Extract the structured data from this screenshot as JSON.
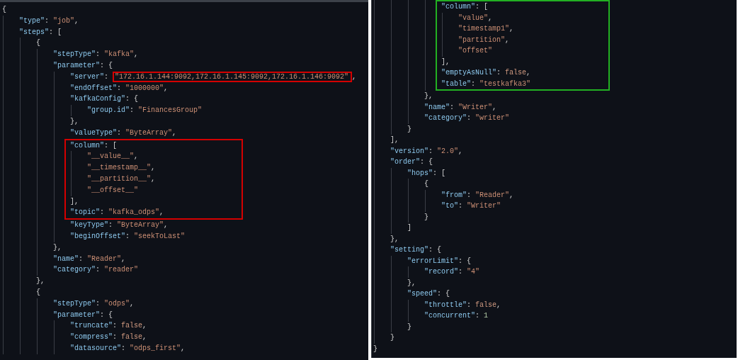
{
  "left": {
    "lines": [
      {
        "kind": "line",
        "tokens": [
          {
            "kind": "punct",
            "text": "{"
          }
        ],
        "children": [
          {
            "kind": "line",
            "tokens": [
              {
                "kind": "key",
                "text": "\"type\""
              },
              {
                "kind": "punct",
                "text": ": "
              },
              {
                "kind": "str",
                "text": "\"job\""
              },
              {
                "kind": "punct",
                "text": ","
              }
            ]
          },
          {
            "kind": "line",
            "tokens": [
              {
                "kind": "key",
                "text": "\"steps\""
              },
              {
                "kind": "punct",
                "text": ": ["
              }
            ],
            "children": [
              {
                "kind": "line",
                "tokens": [
                  {
                    "kind": "punct",
                    "text": "{"
                  }
                ],
                "children": [
                  {
                    "kind": "line",
                    "tokens": [
                      {
                        "kind": "key",
                        "text": "\"stepType\""
                      },
                      {
                        "kind": "punct",
                        "text": ": "
                      },
                      {
                        "kind": "str",
                        "text": "\"kafka\""
                      },
                      {
                        "kind": "punct",
                        "text": ","
                      }
                    ]
                  },
                  {
                    "kind": "line",
                    "tokens": [
                      {
                        "kind": "key",
                        "text": "\"parameter\""
                      },
                      {
                        "kind": "punct",
                        "text": ": {"
                      }
                    ],
                    "children": [
                      {
                        "kind": "line",
                        "tokens": [
                          {
                            "kind": "key",
                            "text": "\"server\""
                          },
                          {
                            "kind": "punct",
                            "text": ": "
                          },
                          {
                            "kind": "str",
                            "text": "\"172.16.1.144:9092,172.16.1.145:9092,172.16.1.146:9092\"",
                            "color": "#d40000"
                          },
                          {
                            "kind": "punct",
                            "text": ","
                          }
                        ]
                      },
                      {
                        "kind": "line",
                        "tokens": [
                          {
                            "kind": "key",
                            "text": "\"endOffset\""
                          },
                          {
                            "kind": "punct",
                            "text": ": "
                          },
                          {
                            "kind": "str",
                            "text": "\"1000000\""
                          },
                          {
                            "kind": "punct",
                            "text": ","
                          }
                        ]
                      },
                      {
                        "kind": "line",
                        "tokens": [
                          {
                            "kind": "key",
                            "text": "\"kafkaConfig\""
                          },
                          {
                            "kind": "punct",
                            "text": ": {"
                          }
                        ],
                        "children": [
                          {
                            "kind": "line",
                            "tokens": [
                              {
                                "kind": "key",
                                "text": "\"group.id\""
                              },
                              {
                                "kind": "punct",
                                "text": ": "
                              },
                              {
                                "kind": "str",
                                "text": "\"FinancesGroup\""
                              }
                            ]
                          }
                        ],
                        "close": [
                          {
                            "kind": "punct",
                            "text": "},"
                          }
                        ]
                      },
                      {
                        "kind": "line",
                        "tokens": [
                          {
                            "kind": "key",
                            "text": "\"valueType\""
                          },
                          {
                            "kind": "punct",
                            "text": ": "
                          },
                          {
                            "kind": "str",
                            "text": "\"ByteArray\""
                          },
                          {
                            "kind": "punct",
                            "text": ","
                          }
                        ]
                      },
                      {
                        "kind": "box",
                        "color": "#d40000",
                        "lines": [
                          {
                            "kind": "line",
                            "tokens": [
                              {
                                "kind": "key",
                                "text": "\"column\""
                              },
                              {
                                "kind": "punct",
                                "text": ": ["
                              }
                            ],
                            "children": [
                              {
                                "kind": "line",
                                "tokens": [
                                  {
                                    "kind": "str",
                                    "text": "\"__value__\""
                                  },
                                  {
                                    "kind": "punct",
                                    "text": ","
                                  }
                                ]
                              },
                              {
                                "kind": "line",
                                "tokens": [
                                  {
                                    "kind": "str",
                                    "text": "\"__timestamp__\""
                                  },
                                  {
                                    "kind": "punct",
                                    "text": ","
                                  }
                                ]
                              },
                              {
                                "kind": "line",
                                "tokens": [
                                  {
                                    "kind": "str",
                                    "text": "\"__partition__\""
                                  },
                                  {
                                    "kind": "punct",
                                    "text": ","
                                  }
                                ]
                              },
                              {
                                "kind": "line",
                                "tokens": [
                                  {
                                    "kind": "str",
                                    "text": "\"__offset__\""
                                  }
                                ]
                              }
                            ],
                            "close": [
                              {
                                "kind": "punct",
                                "text": "],"
                              }
                            ]
                          },
                          {
                            "kind": "line",
                            "tokens": [
                              {
                                "kind": "key",
                                "text": "\"topic\""
                              },
                              {
                                "kind": "punct",
                                "text": ": "
                              },
                              {
                                "kind": "str",
                                "text": "\"kafka_odps\""
                              },
                              {
                                "kind": "punct",
                                "text": ","
                              }
                            ]
                          }
                        ]
                      },
                      {
                        "kind": "line",
                        "tokens": [
                          {
                            "kind": "key",
                            "text": "\"keyType\""
                          },
                          {
                            "kind": "punct",
                            "text": ": "
                          },
                          {
                            "kind": "str",
                            "text": "\"ByteArray\""
                          },
                          {
                            "kind": "punct",
                            "text": ","
                          }
                        ]
                      },
                      {
                        "kind": "line",
                        "tokens": [
                          {
                            "kind": "key",
                            "text": "\"beginOffset\""
                          },
                          {
                            "kind": "punct",
                            "text": ": "
                          },
                          {
                            "kind": "str",
                            "text": "\"seekToLast\""
                          }
                        ]
                      }
                    ],
                    "close": [
                      {
                        "kind": "punct",
                        "text": "},"
                      }
                    ]
                  },
                  {
                    "kind": "line",
                    "tokens": [
                      {
                        "kind": "key",
                        "text": "\"name\""
                      },
                      {
                        "kind": "punct",
                        "text": ": "
                      },
                      {
                        "kind": "str",
                        "text": "\"Reader\""
                      },
                      {
                        "kind": "punct",
                        "text": ","
                      }
                    ]
                  },
                  {
                    "kind": "line",
                    "tokens": [
                      {
                        "kind": "key",
                        "text": "\"category\""
                      },
                      {
                        "kind": "punct",
                        "text": ": "
                      },
                      {
                        "kind": "str",
                        "text": "\"reader\""
                      }
                    ]
                  }
                ],
                "close": [
                  {
                    "kind": "punct",
                    "text": "},"
                  }
                ]
              },
              {
                "kind": "line",
                "tokens": [
                  {
                    "kind": "punct",
                    "text": "{"
                  }
                ],
                "children": [
                  {
                    "kind": "line",
                    "tokens": [
                      {
                        "kind": "key",
                        "text": "\"stepType\""
                      },
                      {
                        "kind": "punct",
                        "text": ": "
                      },
                      {
                        "kind": "str",
                        "text": "\"odps\""
                      },
                      {
                        "kind": "punct",
                        "text": ","
                      }
                    ]
                  },
                  {
                    "kind": "line",
                    "tokens": [
                      {
                        "kind": "key",
                        "text": "\"parameter\""
                      },
                      {
                        "kind": "punct",
                        "text": ": {"
                      }
                    ],
                    "children": [
                      {
                        "kind": "line",
                        "tokens": [
                          {
                            "kind": "key",
                            "text": "\"truncate\""
                          },
                          {
                            "kind": "punct",
                            "text": ": "
                          },
                          {
                            "kind": "bool",
                            "text": "false"
                          },
                          {
                            "kind": "punct",
                            "text": ","
                          }
                        ]
                      },
                      {
                        "kind": "line",
                        "tokens": [
                          {
                            "kind": "key",
                            "text": "\"compress\""
                          },
                          {
                            "kind": "punct",
                            "text": ": "
                          },
                          {
                            "kind": "bool",
                            "text": "false"
                          },
                          {
                            "kind": "punct",
                            "text": ","
                          }
                        ]
                      },
                      {
                        "kind": "line",
                        "tokens": [
                          {
                            "kind": "key",
                            "text": "\"datasource\""
                          },
                          {
                            "kind": "punct",
                            "text": ": "
                          },
                          {
                            "kind": "str",
                            "text": "\"odps_first\""
                          },
                          {
                            "kind": "punct",
                            "text": ","
                          }
                        ]
                      }
                    ]
                  }
                ]
              }
            ]
          }
        ]
      }
    ]
  },
  "right": {
    "lines": [
      {
        "kind": "line",
        "children": [
          {
            "kind": "line",
            "children": [
              {
                "kind": "line",
                "children": [
                  {
                    "kind": "line",
                    "children": [
                      {
                        "kind": "box",
                        "color": "#22b022",
                        "lines": [
                          {
                            "kind": "line",
                            "tokens": [
                              {
                                "kind": "key",
                                "text": "\"column\""
                              },
                              {
                                "kind": "punct",
                                "text": ": ["
                              }
                            ],
                            "children": [
                              {
                                "kind": "line",
                                "tokens": [
                                  {
                                    "kind": "str",
                                    "text": "\"value\""
                                  },
                                  {
                                    "kind": "punct",
                                    "text": ","
                                  }
                                ]
                              },
                              {
                                "kind": "line",
                                "tokens": [
                                  {
                                    "kind": "str",
                                    "text": "\"timestamp1\""
                                  },
                                  {
                                    "kind": "punct",
                                    "text": ","
                                  }
                                ]
                              },
                              {
                                "kind": "line",
                                "tokens": [
                                  {
                                    "kind": "str",
                                    "text": "\"partition\""
                                  },
                                  {
                                    "kind": "punct",
                                    "text": ","
                                  }
                                ]
                              },
                              {
                                "kind": "line",
                                "tokens": [
                                  {
                                    "kind": "str",
                                    "text": "\"offset\""
                                  }
                                ]
                              }
                            ],
                            "close": [
                              {
                                "kind": "punct",
                                "text": "],"
                              }
                            ]
                          },
                          {
                            "kind": "line",
                            "tokens": [
                              {
                                "kind": "key",
                                "text": "\"emptyAsNull\""
                              },
                              {
                                "kind": "punct",
                                "text": ": "
                              },
                              {
                                "kind": "bool",
                                "text": "false"
                              },
                              {
                                "kind": "punct",
                                "text": ","
                              }
                            ]
                          },
                          {
                            "kind": "line",
                            "tokens": [
                              {
                                "kind": "key",
                                "text": "\"table\""
                              },
                              {
                                "kind": "punct",
                                "text": ": "
                              },
                              {
                                "kind": "str",
                                "text": "\"testkafka3\""
                              }
                            ]
                          }
                        ]
                      }
                    ],
                    "close": [
                      {
                        "kind": "punct",
                        "text": "},"
                      }
                    ]
                  },
                  {
                    "kind": "line",
                    "tokens": [
                      {
                        "kind": "key",
                        "text": "\"name\""
                      },
                      {
                        "kind": "punct",
                        "text": ": "
                      },
                      {
                        "kind": "str",
                        "text": "\"Writer\""
                      },
                      {
                        "kind": "punct",
                        "text": ","
                      }
                    ]
                  },
                  {
                    "kind": "line",
                    "tokens": [
                      {
                        "kind": "key",
                        "text": "\"category\""
                      },
                      {
                        "kind": "punct",
                        "text": ": "
                      },
                      {
                        "kind": "str",
                        "text": "\"writer\""
                      }
                    ]
                  }
                ],
                "close": [
                  {
                    "kind": "punct",
                    "text": "}"
                  }
                ]
              }
            ],
            "close": [
              {
                "kind": "punct",
                "text": "],"
              }
            ]
          },
          {
            "kind": "line",
            "tokens": [
              {
                "kind": "key",
                "text": "\"version\""
              },
              {
                "kind": "punct",
                "text": ": "
              },
              {
                "kind": "str",
                "text": "\"2.0\""
              },
              {
                "kind": "punct",
                "text": ","
              }
            ]
          },
          {
            "kind": "line",
            "tokens": [
              {
                "kind": "key",
                "text": "\"order\""
              },
              {
                "kind": "punct",
                "text": ": {"
              }
            ],
            "children": [
              {
                "kind": "line",
                "tokens": [
                  {
                    "kind": "key",
                    "text": "\"hops\""
                  },
                  {
                    "kind": "punct",
                    "text": ": ["
                  }
                ],
                "children": [
                  {
                    "kind": "line",
                    "tokens": [
                      {
                        "kind": "punct",
                        "text": "{"
                      }
                    ],
                    "children": [
                      {
                        "kind": "line",
                        "tokens": [
                          {
                            "kind": "key",
                            "text": "\"from\""
                          },
                          {
                            "kind": "punct",
                            "text": ": "
                          },
                          {
                            "kind": "str",
                            "text": "\"Reader\""
                          },
                          {
                            "kind": "punct",
                            "text": ","
                          }
                        ]
                      },
                      {
                        "kind": "line",
                        "tokens": [
                          {
                            "kind": "key",
                            "text": "\"to\""
                          },
                          {
                            "kind": "punct",
                            "text": ": "
                          },
                          {
                            "kind": "str",
                            "text": "\"Writer\""
                          }
                        ]
                      }
                    ],
                    "close": [
                      {
                        "kind": "punct",
                        "text": "}"
                      }
                    ]
                  }
                ],
                "close": [
                  {
                    "kind": "punct",
                    "text": "]"
                  }
                ]
              }
            ],
            "close": [
              {
                "kind": "punct",
                "text": "},"
              }
            ]
          },
          {
            "kind": "line",
            "tokens": [
              {
                "kind": "key",
                "text": "\"setting\""
              },
              {
                "kind": "punct",
                "text": ": {"
              }
            ],
            "children": [
              {
                "kind": "line",
                "tokens": [
                  {
                    "kind": "key",
                    "text": "\"errorLimit\""
                  },
                  {
                    "kind": "punct",
                    "text": ": {"
                  }
                ],
                "children": [
                  {
                    "kind": "line",
                    "tokens": [
                      {
                        "kind": "key",
                        "text": "\"record\""
                      },
                      {
                        "kind": "punct",
                        "text": ": "
                      },
                      {
                        "kind": "str",
                        "text": "\"4\""
                      }
                    ]
                  }
                ],
                "close": [
                  {
                    "kind": "punct",
                    "text": "},"
                  }
                ]
              },
              {
                "kind": "line",
                "tokens": [
                  {
                    "kind": "key",
                    "text": "\"speed\""
                  },
                  {
                    "kind": "punct",
                    "text": ": {"
                  }
                ],
                "children": [
                  {
                    "kind": "line",
                    "tokens": [
                      {
                        "kind": "key",
                        "text": "\"throttle\""
                      },
                      {
                        "kind": "punct",
                        "text": ": "
                      },
                      {
                        "kind": "bool",
                        "text": "false"
                      },
                      {
                        "kind": "punct",
                        "text": ","
                      }
                    ]
                  },
                  {
                    "kind": "line",
                    "tokens": [
                      {
                        "kind": "key",
                        "text": "\"concurrent\""
                      },
                      {
                        "kind": "punct",
                        "text": ": "
                      },
                      {
                        "kind": "num",
                        "text": "1"
                      }
                    ]
                  }
                ],
                "close": [
                  {
                    "kind": "punct",
                    "text": "}"
                  }
                ]
              }
            ],
            "close": [
              {
                "kind": "punct",
                "text": "}"
              }
            ]
          }
        ],
        "close": [
          {
            "kind": "punct",
            "text": "}"
          }
        ]
      }
    ]
  }
}
